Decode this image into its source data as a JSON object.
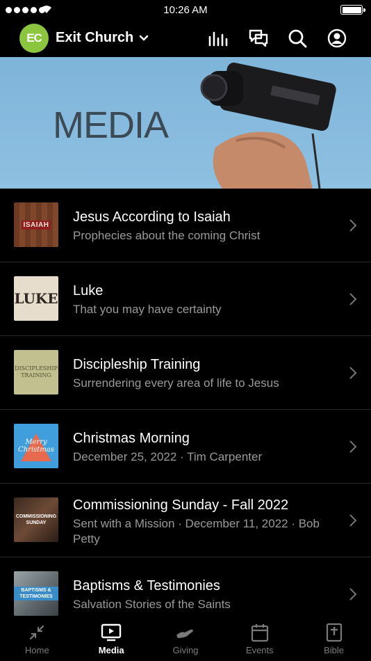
{
  "status_bar": {
    "time": "10:26 AM"
  },
  "header": {
    "logo_text": "EC",
    "church_name": "Exit Church",
    "icons": [
      "audio-bars-icon",
      "chat-icon",
      "search-icon",
      "profile-icon"
    ]
  },
  "banner": {
    "title": "MEDIA"
  },
  "media_list": [
    {
      "title": "Jesus According to Isaiah",
      "subtitle": "Prophecies about the coming Christ",
      "thumb_text": "ISAIAH"
    },
    {
      "title": "Luke",
      "subtitle": "That you may have certainty",
      "thumb_text": "LUKE"
    },
    {
      "title": "Discipleship Training",
      "subtitle": "Surrendering every area of life to Jesus",
      "thumb_text": "DISCIPLESHIP TRAINING"
    },
    {
      "title": "Christmas Morning",
      "subtitle": "December 25, 2022 · Tim Carpenter",
      "thumb_text": "Merry Christmas"
    },
    {
      "title": "Commissioning Sunday - Fall 2022",
      "subtitle": "Sent with a Mission · December 11, 2022 · Bob Petty",
      "thumb_text": "COMMISSIONING SUNDAY"
    },
    {
      "title": "Baptisms & Testimonies",
      "subtitle": "Salvation Stories of the Saints",
      "thumb_text": "BAPTISMS & TESTIMONIES"
    }
  ],
  "tabs": [
    {
      "label": "Home",
      "icon": "collapse-arrows-icon",
      "active": false
    },
    {
      "label": "Media",
      "icon": "tv-icon",
      "active": true
    },
    {
      "label": "Giving",
      "icon": "giving-hand-icon",
      "active": false
    },
    {
      "label": "Events",
      "icon": "calendar-icon",
      "active": false
    },
    {
      "label": "Bible",
      "icon": "bible-icon",
      "active": false
    }
  ],
  "colors": {
    "logo": "#8cc63f",
    "banner_bg": "#8ec0e2",
    "subtitle": "#9a9a9a"
  }
}
